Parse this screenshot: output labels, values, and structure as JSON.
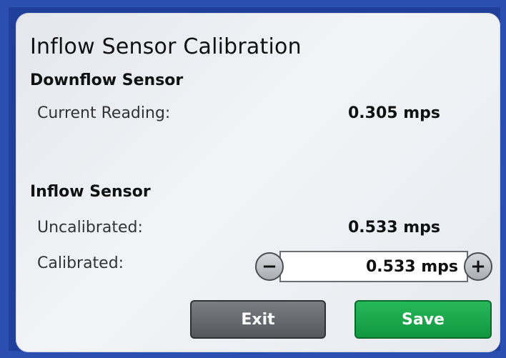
{
  "title": "Inflow Sensor Calibration",
  "downflow": {
    "section_label": "Downflow Sensor",
    "current_label": "Current Reading:",
    "current_value": "0.305 mps"
  },
  "inflow": {
    "section_label": "Inflow Sensor",
    "uncalibrated_label": "Uncalibrated:",
    "uncalibrated_value": "0.533 mps",
    "calibrated_label": "Calibrated:",
    "calibrated_value": "0.533 mps",
    "minus_symbol": "−",
    "plus_symbol": "+"
  },
  "buttons": {
    "exit_label": "Exit",
    "save_label": "Save"
  },
  "colors": {
    "frame": "#2a4fb0",
    "exit": "#666a70",
    "save": "#1ea84d"
  }
}
